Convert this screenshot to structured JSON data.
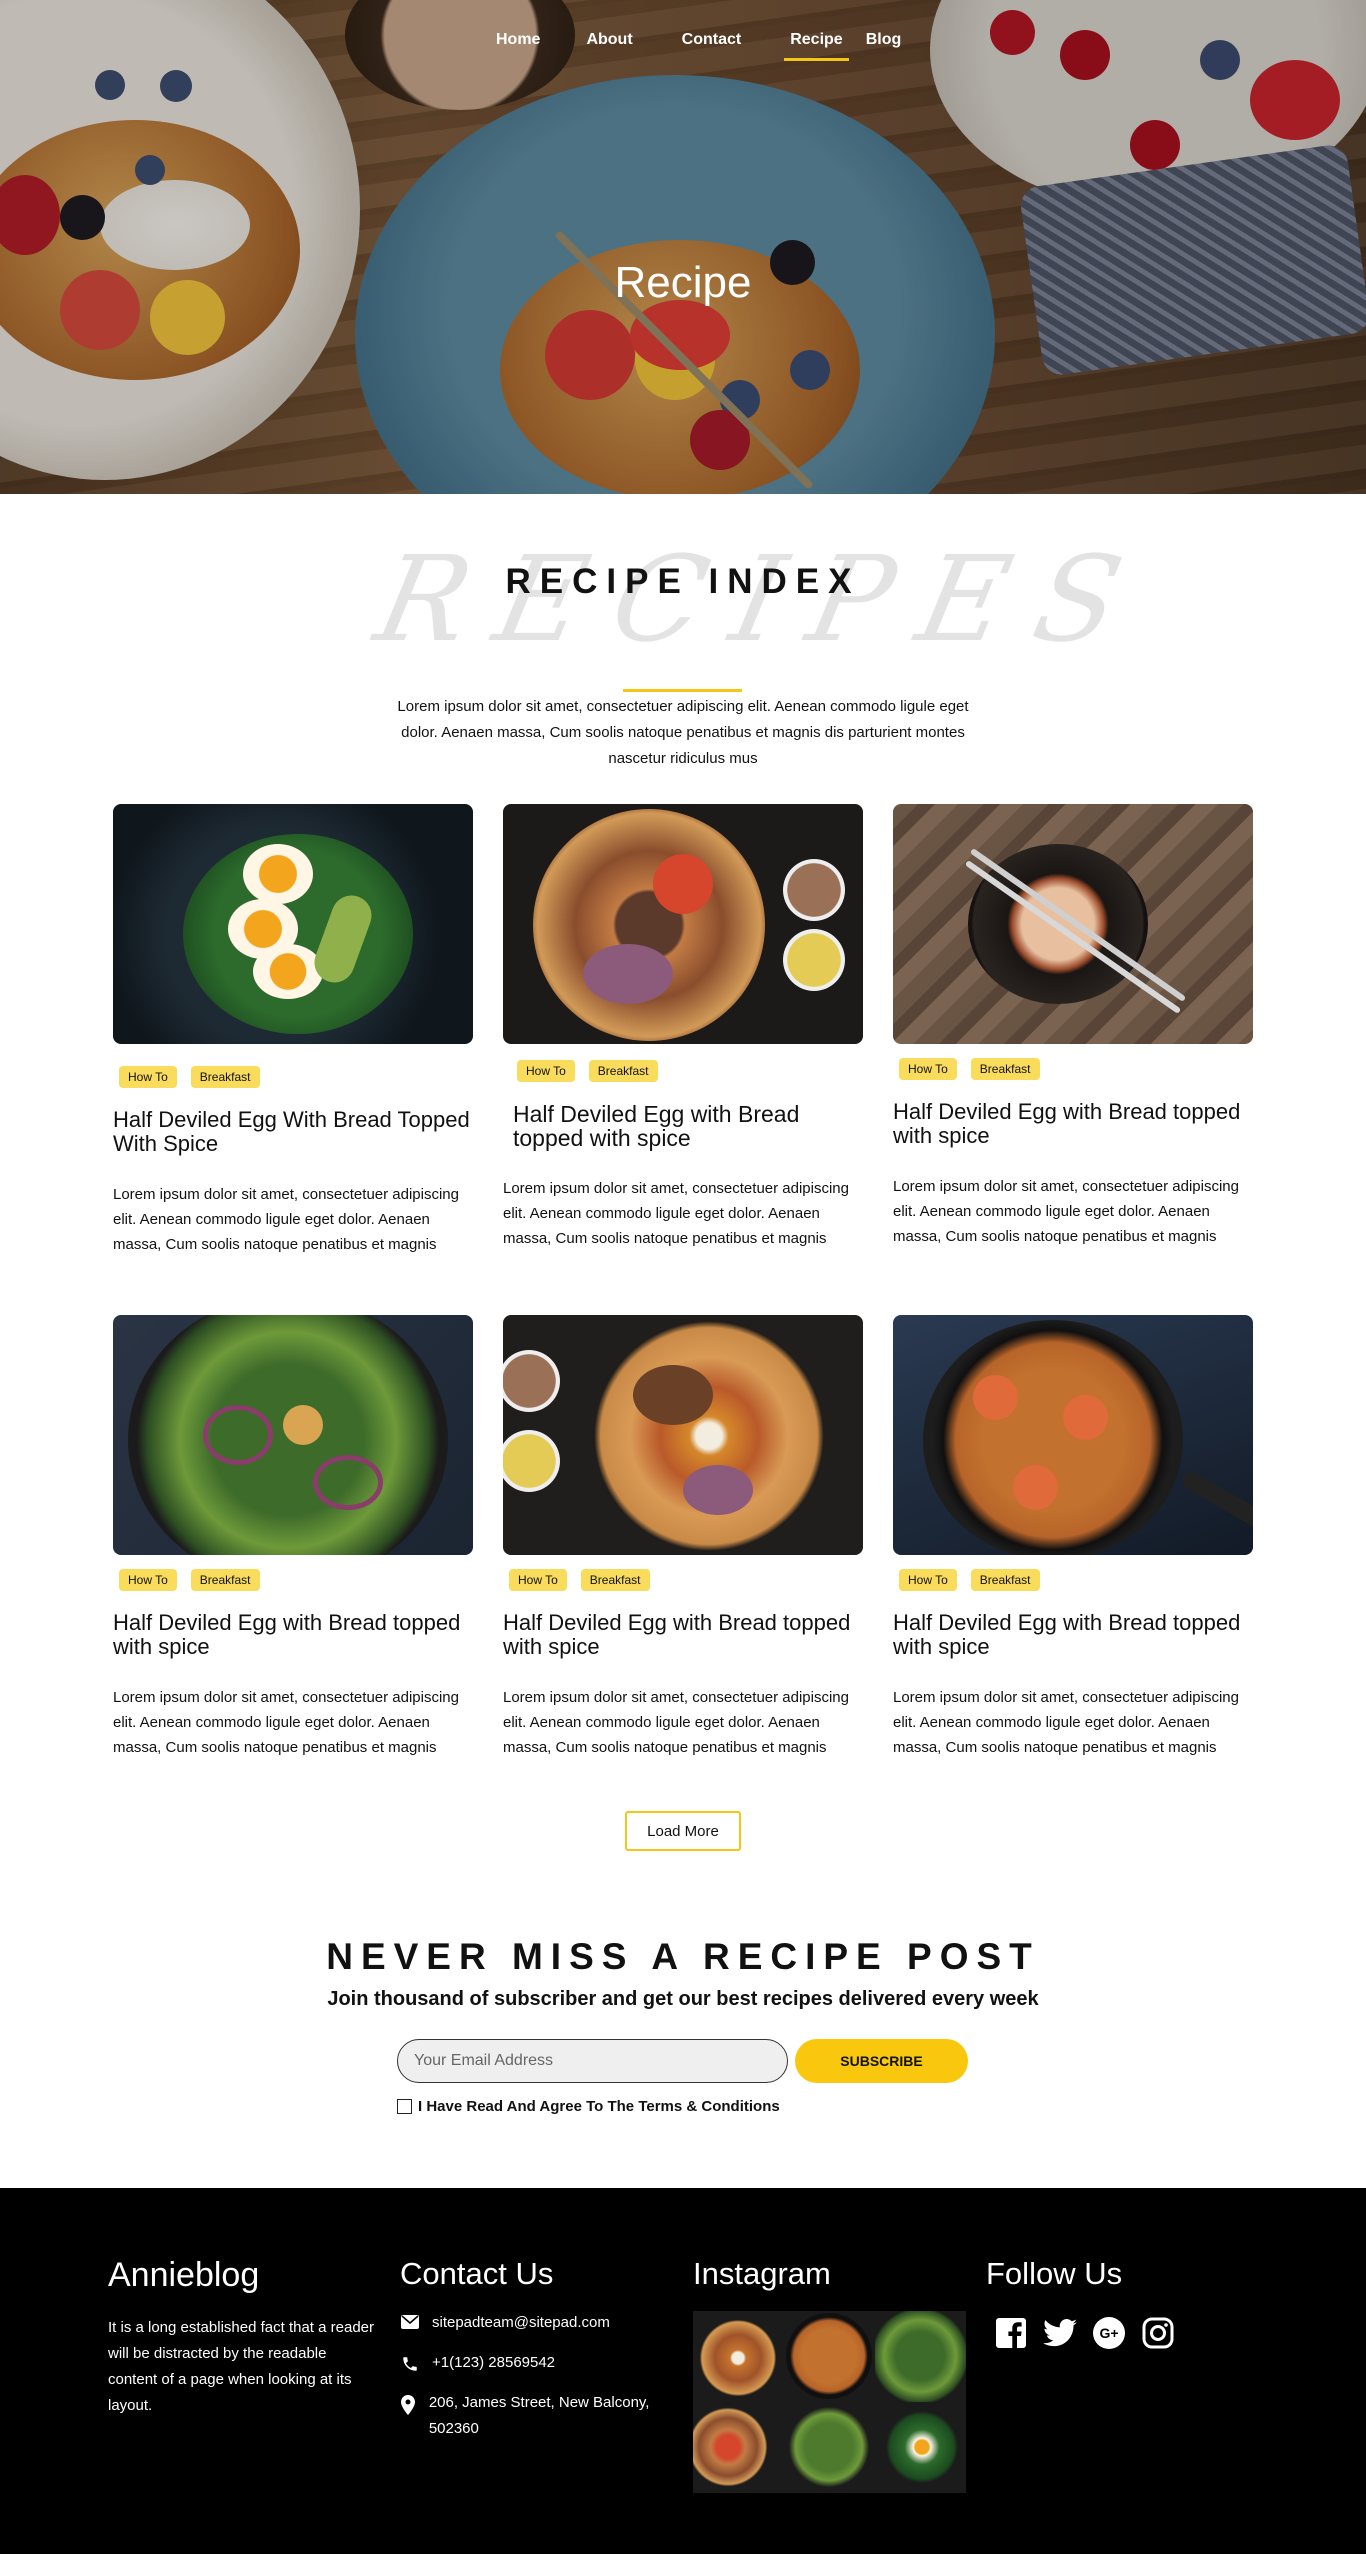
{
  "nav": {
    "items": [
      {
        "label": "Home"
      },
      {
        "label": "About"
      },
      {
        "label": "Contact"
      },
      {
        "label": "Recipe",
        "active": true
      },
      {
        "label": "Blog"
      }
    ]
  },
  "hero": {
    "title": "Recipe"
  },
  "recipe_index": {
    "script_background": "RECIPES",
    "title": "RECIPE INDEX",
    "intro": "Lorem ipsum dolor sit amet, consectetuer adipiscing elit. Aenean commodo ligule eget dolor. Aenaen massa, Cum soolis natoque penatibus et magnis dis parturient montes nascetur ridiculus mus"
  },
  "cards": [
    {
      "tags": [
        "How To",
        "Breakfast"
      ],
      "title": "Half Deviled Egg With Bread Topped With Spice",
      "text": "Lorem ipsum dolor sit amet, consectetuer adipiscing elit. Aenean commodo ligule eget dolor. Aenaen massa, Cum soolis natoque penatibus et magnis",
      "image": "egg-avocado-salad"
    },
    {
      "tags": [
        "How To",
        "Breakfast"
      ],
      "title": "Half Deviled Egg with Bread topped with spice",
      "text": "Lorem ipsum dolor sit amet, consectetuer adipiscing elit. Aenean commodo ligule eget dolor. Aenaen massa, Cum soolis natoque penatibus et magnis",
      "image": "noodle-bowl"
    },
    {
      "tags": [
        "How To",
        "Breakfast"
      ],
      "title": "Half Deviled Egg with Bread topped with spice",
      "text": "Lorem ipsum dolor sit amet, consectetuer adipiscing elit. Aenean commodo ligule eget dolor. Aenaen massa, Cum soolis natoque penatibus et magnis",
      "image": "stone-pot-chopsticks"
    },
    {
      "tags": [
        "How To",
        "Breakfast"
      ],
      "title": "Half Deviled Egg with Bread topped with spice",
      "text": "Lorem ipsum dolor sit amet, consectetuer adipiscing elit. Aenean commodo ligule eget dolor. Aenaen massa, Cum soolis natoque penatibus et magnis",
      "image": "green-salad"
    },
    {
      "tags": [
        "How To",
        "Breakfast"
      ],
      "title": "Half Deviled Egg with Bread topped with spice",
      "text": "Lorem ipsum dolor sit amet, consectetuer adipiscing elit. Aenean commodo ligule eget dolor. Aenaen massa, Cum soolis natoque penatibus et magnis",
      "image": "ramen-bowl"
    },
    {
      "tags": [
        "How To",
        "Breakfast"
      ],
      "title": "Half Deviled Egg with Bread topped with spice",
      "text": "Lorem ipsum dolor sit amet, consectetuer adipiscing elit. Aenean commodo ligule eget dolor. Aenaen massa, Cum soolis natoque penatibus et magnis",
      "image": "shrimp-spaghetti-pan"
    }
  ],
  "load_more": "Load More",
  "newsletter": {
    "title": "NEVER MISS A RECIPE POST",
    "subtitle": "Join thousand of subscriber and get our best recipes delivered every week",
    "email_placeholder": "Your Email Address",
    "subscribe_label": "SUBSCRIBE",
    "agree_label": "I Have Read And Agree To The Terms & Conditions"
  },
  "footer": {
    "brand": "Annieblog",
    "about": "It is a long established fact that a reader will be distracted by the readable content of a page when looking at its layout.",
    "contact": {
      "title": "Contact Us",
      "email": "sitepadteam@sitepad.com",
      "phone": "+1(123) 28569542",
      "address": "206, James Street, New Balcony, 502360"
    },
    "instagram": {
      "title": "Instagram"
    },
    "follow": {
      "title": "Follow Us",
      "icons": [
        "facebook-icon",
        "twitter-icon",
        "google-plus-icon",
        "instagram-icon"
      ]
    }
  },
  "colors": {
    "accent": "#f5c518",
    "tag": "#f9dc5c",
    "footer_bg": "#000000"
  }
}
